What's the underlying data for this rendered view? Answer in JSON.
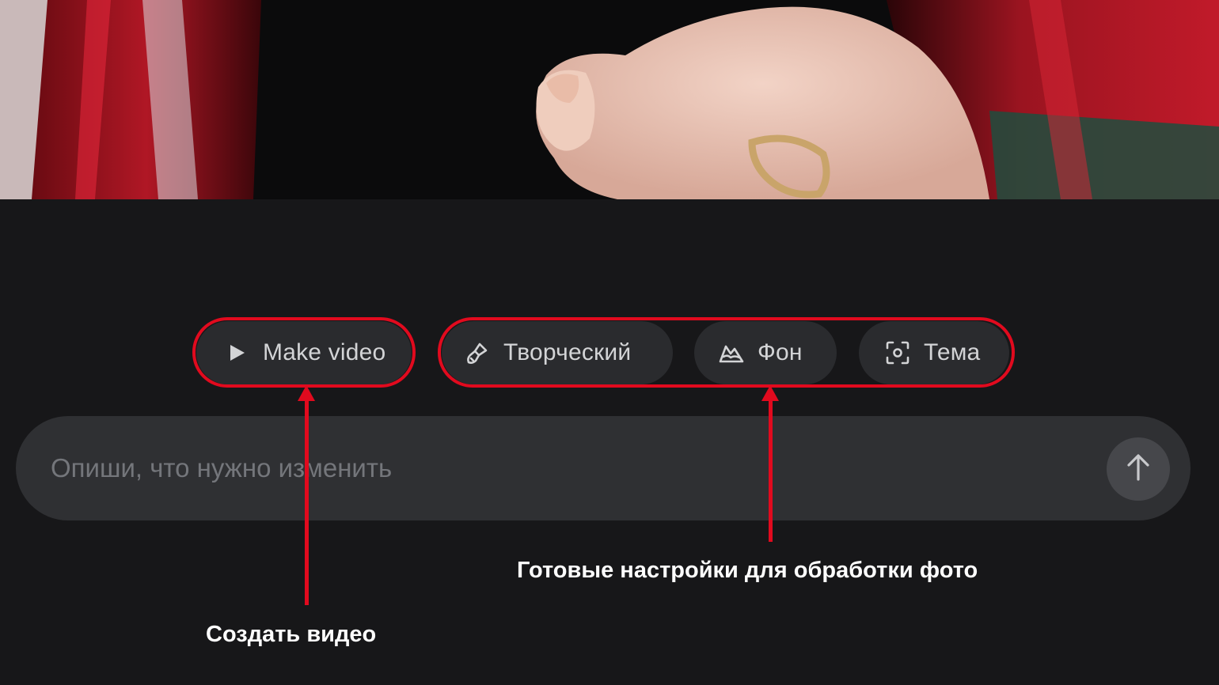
{
  "chips": {
    "make_video": {
      "label": "Make video",
      "icon": "play-icon"
    },
    "creative": {
      "label": "Творческий",
      "icon": "brush-icon"
    },
    "background": {
      "label": "Фон",
      "icon": "mountain-icon"
    },
    "theme": {
      "label": "Тема",
      "icon": "focus-frame-icon"
    }
  },
  "prompt": {
    "placeholder": "Опиши, что нужно изменить",
    "send_icon": "arrow-up-icon"
  },
  "annotations": {
    "make_video": "Создать видео",
    "presets": "Готовые настройки для обработки фото"
  },
  "colors": {
    "background": "#171719",
    "chip": "#2a2b2e",
    "prompt_bar": "#2f3033",
    "highlight": "#e10a1e"
  }
}
